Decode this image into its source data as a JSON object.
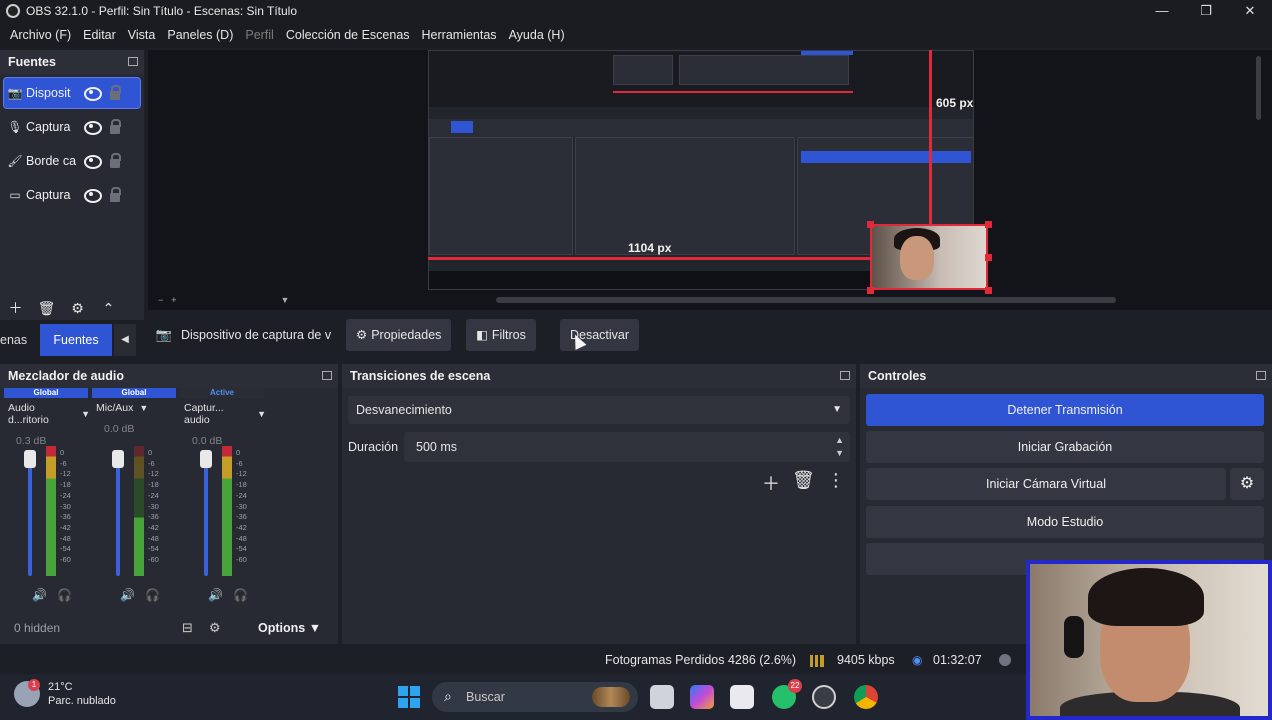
{
  "window": {
    "title": "OBS 32.1.0 - Perfil: Sin Título - Escenas: Sin Título",
    "controls": [
      "—",
      "❐",
      "✕"
    ]
  },
  "menu": [
    "Archivo (F)",
    "Editar",
    "Vista",
    "Paneles (D)",
    "Perfil",
    "Colección de Escenas",
    "Herramientas",
    "Ayuda (H)"
  ],
  "sources": {
    "title": "Fuentes",
    "items": [
      {
        "label": "Disposit",
        "icon": "camera-icon",
        "selected": true
      },
      {
        "label": "Captura",
        "icon": "microphone-icon",
        "selected": false
      },
      {
        "label": "Borde ca",
        "icon": "brush-icon",
        "selected": false
      },
      {
        "label": "Captura",
        "icon": "monitor-icon",
        "selected": false
      }
    ],
    "toolbar": [
      "＋",
      "🗑",
      "⚙",
      "⌃"
    ]
  },
  "preview": {
    "width_label": "605 px",
    "height_label": "1104 px"
  },
  "dock_tabs": {
    "scenes_partial": "enas",
    "sources": "Fuentes"
  },
  "context_bar": {
    "source_name": "Dispositivo de captura de v",
    "properties": "Propiedades",
    "filters": "Filtros",
    "deactivate": "Desactivar"
  },
  "mixer": {
    "title": "Mezclador de audio",
    "channels": [
      {
        "badge": "Global",
        "name": "Audio d...ritorio",
        "db": "0.3 dB",
        "level": 0.85
      },
      {
        "badge": "Global",
        "name": "Mic/Aux",
        "db": "0.0 dB",
        "level": 0.45
      },
      {
        "badge": "Active",
        "name": "Captur... audio",
        "db": "0.0 dB",
        "level": 0.85
      }
    ],
    "ticks": [
      "0",
      "-6",
      "-12",
      "-18",
      "-24",
      "-30",
      "-36",
      "-42",
      "-48",
      "-54",
      "-60"
    ],
    "hidden": "0 hidden",
    "options": "Options"
  },
  "transitions": {
    "title": "Transiciones de escena",
    "selected": "Desvanecimiento",
    "duration_label": "Duración",
    "duration_value": "500 ms"
  },
  "controls": {
    "title": "Controles",
    "stop_stream": "Detener Transmisión",
    "start_recording": "Iniciar Grabación",
    "virtual_camera": "Iniciar Cámara Virtual",
    "studio_mode": "Modo Estudio"
  },
  "status": {
    "dropped_frames": "Fotogramas Perdidos 4286 (2.6%)",
    "bitrate": "9405 kbps",
    "stream_time": "01:32:07"
  },
  "taskbar": {
    "temp": "21°C",
    "weather": "Parc. nublado",
    "weather_badge": "1",
    "search": "Buscar",
    "whatsapp_badge": "22"
  },
  "colors": {
    "accent": "#2f55d4",
    "red_guide": "#e02a3a",
    "panel": "#272a33",
    "webcam_border": "#2228c9"
  }
}
